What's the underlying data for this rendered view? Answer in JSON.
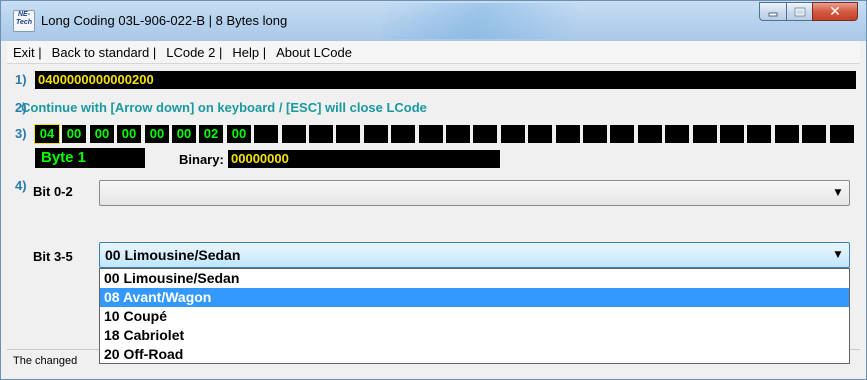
{
  "window": {
    "icon_text": "NE-Tech",
    "title": "Long Coding  03L-906-022-B | 8 Bytes long"
  },
  "menu": [
    "Exit |",
    "Back to standard |",
    "LCode 2 |",
    "Help |",
    "About LCode"
  ],
  "row1": {
    "num": "1)",
    "coding": "0400000000000200"
  },
  "row2": {
    "num": "2)",
    "hint": "Continue with [Arrow down] on keyboard / [ESC] will close LCode"
  },
  "row3": {
    "num": "3)",
    "bytes": [
      "04",
      "00",
      "00",
      "00",
      "00",
      "00",
      "02",
      "00",
      "",
      "",
      "",
      "",
      "",
      "",
      "",
      "",
      "",
      "",
      "",
      "",
      "",
      "",
      "",
      "",
      "",
      "",
      "",
      "",
      "",
      ""
    ],
    "selected_byte": "Byte 1",
    "binary_label": "Binary:",
    "binary_value": "00000000"
  },
  "row4": {
    "num": "4)",
    "bit02_label": "Bit 0-2",
    "bit02_value": "",
    "bit35_label": "Bit 3-5",
    "bit35_value": "00 Limousine/Sedan",
    "bit35_options": [
      "00 Limousine/Sedan",
      "08 Avant/Wagon",
      "10 Coupé",
      "18 Cabriolet",
      "20 Off-Road"
    ],
    "highlighted_option": "08 Avant/Wagon"
  },
  "status": {
    "left": "The changed",
    "right": ""
  },
  "colors": {
    "byte_green": "#00ff00",
    "binary_yellow": "#f5e100",
    "label_blue": "#2a7ab0",
    "hint_teal": "#1a9aa0",
    "selection": "#3399ff"
  }
}
